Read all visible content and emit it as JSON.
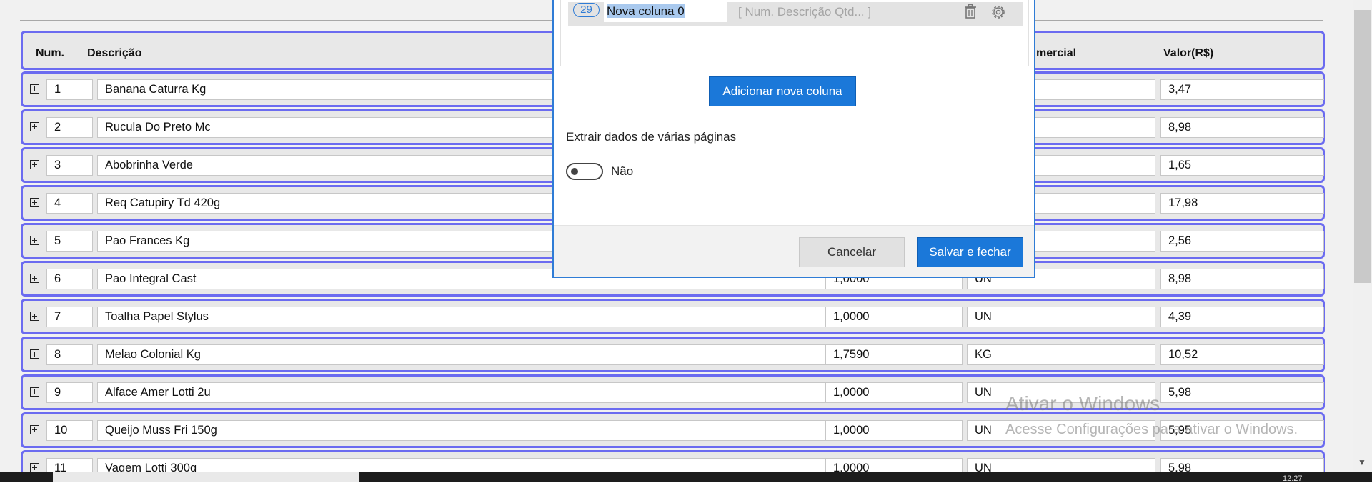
{
  "table": {
    "headers": {
      "num": "Num.",
      "desc": "Descrição",
      "unidade_partial": "mercial",
      "valor": "Valor(R$)"
    },
    "rows": [
      {
        "num": "1",
        "desc": "Banana Caturra Kg",
        "qty": "",
        "un": "",
        "val": "3,47"
      },
      {
        "num": "2",
        "desc": "Rucula Do Preto Mc",
        "qty": "",
        "un": "",
        "val": "8,98"
      },
      {
        "num": "3",
        "desc": "Abobrinha Verde",
        "qty": "",
        "un": "",
        "val": "1,65"
      },
      {
        "num": "4",
        "desc": "Req Catupiry Td 420g",
        "qty": "",
        "un": "",
        "val": "17,98"
      },
      {
        "num": "5",
        "desc": "Pao Frances Kg",
        "qty": "",
        "un": "",
        "val": "2,56"
      },
      {
        "num": "6",
        "desc": "Pao Integral Cast",
        "qty": "1,0000",
        "un": "UN",
        "val": "8,98"
      },
      {
        "num": "7",
        "desc": "Toalha Papel Stylus",
        "qty": "1,0000",
        "un": "UN",
        "val": "4,39"
      },
      {
        "num": "8",
        "desc": "Melao Colonial Kg",
        "qty": "1,7590",
        "un": "KG",
        "val": "10,52"
      },
      {
        "num": "9",
        "desc": "Alface Amer Lotti 2u",
        "qty": "1,0000",
        "un": "UN",
        "val": "5,98"
      },
      {
        "num": "10",
        "desc": "Queijo Muss Fri 150g",
        "qty": "1,0000",
        "un": "UN",
        "val": "5,95"
      },
      {
        "num": "11",
        "desc": "Vagem Lotti 300g",
        "qty": "1,0000",
        "un": "UN",
        "val": "5,98"
      }
    ]
  },
  "modal": {
    "column": {
      "badge": "29",
      "name": "Nova coluna 0",
      "hint": "[ Num. Descrição Qtd... ]"
    },
    "add_button": "Adicionar nova coluna",
    "multi_page_title": "Extrair dados de várias páginas",
    "toggle_label": "Não",
    "cancel_button": "Cancelar",
    "save_button": "Salvar e fechar"
  },
  "watermark": {
    "line1": "Ativar o Windows",
    "line2": "Acesse Configurações para ativar o Windows."
  },
  "taskbar": {
    "time": "12:27"
  },
  "colors": {
    "row_border": "#6b6bf0",
    "primary_button": "#1b78d9",
    "modal_border": "#2f7cd6"
  }
}
